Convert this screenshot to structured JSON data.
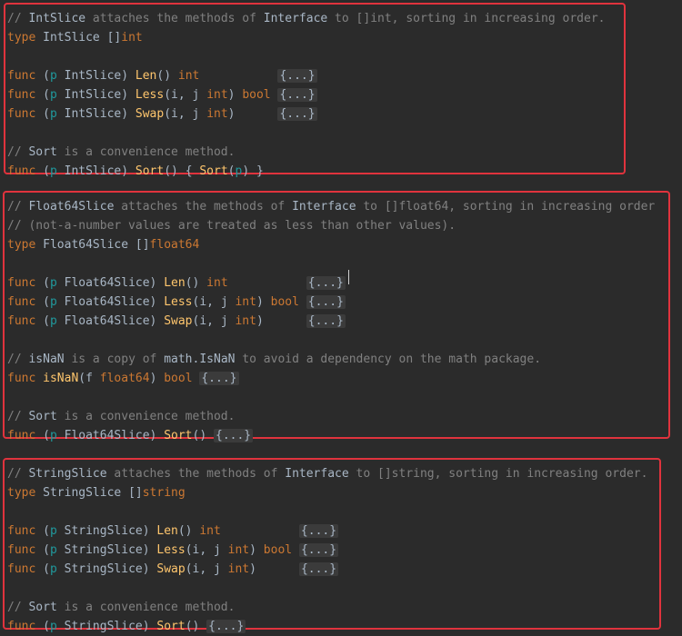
{
  "editor": {
    "blocks": [
      {
        "lines": [
          [
            [
              "c",
              "// "
            ],
            [
              "cb",
              "IntSlice"
            ],
            [
              "c",
              " attaches the methods of "
            ],
            [
              "cb",
              "Interface"
            ],
            [
              "c",
              " to []int, sorting in increasing order."
            ]
          ],
          [
            [
              "k",
              "type "
            ],
            [
              "t",
              "IntSlice "
            ],
            [
              "p",
              "[]"
            ],
            [
              "k",
              "int"
            ]
          ],
          [],
          [
            [
              "k",
              "func "
            ],
            [
              "p",
              "("
            ],
            [
              "r",
              "p "
            ],
            [
              "t",
              "IntSlice"
            ],
            [
              "p",
              ") "
            ],
            [
              "f",
              "Len"
            ],
            [
              "p",
              "() "
            ],
            [
              "k",
              "int"
            ],
            [
              "p",
              "           "
            ],
            [
              "fold",
              "{...}"
            ]
          ],
          [
            [
              "k",
              "func "
            ],
            [
              "p",
              "("
            ],
            [
              "r",
              "p "
            ],
            [
              "t",
              "IntSlice"
            ],
            [
              "p",
              ") "
            ],
            [
              "f",
              "Less"
            ],
            [
              "p",
              "(i, j "
            ],
            [
              "k",
              "int"
            ],
            [
              "p",
              ") "
            ],
            [
              "k",
              "bool"
            ],
            [
              "p",
              " "
            ],
            [
              "fold",
              "{...}"
            ]
          ],
          [
            [
              "k",
              "func "
            ],
            [
              "p",
              "("
            ],
            [
              "r",
              "p "
            ],
            [
              "t",
              "IntSlice"
            ],
            [
              "p",
              ") "
            ],
            [
              "f",
              "Swap"
            ],
            [
              "p",
              "(i, j "
            ],
            [
              "k",
              "int"
            ],
            [
              "p",
              ")      "
            ],
            [
              "fold",
              "{...}"
            ]
          ],
          [],
          [
            [
              "c",
              "// "
            ],
            [
              "cb",
              "Sort"
            ],
            [
              "c",
              " is a convenience method."
            ]
          ],
          [
            [
              "k",
              "func "
            ],
            [
              "p",
              "("
            ],
            [
              "r",
              "p "
            ],
            [
              "t",
              "IntSlice"
            ],
            [
              "p",
              ") "
            ],
            [
              "f",
              "Sort"
            ],
            [
              "p",
              "() { "
            ],
            [
              "f",
              "Sort"
            ],
            [
              "p",
              "("
            ],
            [
              "r",
              "p"
            ],
            [
              "p",
              ") }"
            ]
          ]
        ]
      },
      {
        "lines": [
          [
            [
              "c",
              "// "
            ],
            [
              "cb",
              "Float64Slice"
            ],
            [
              "c",
              " attaches the methods of "
            ],
            [
              "cb",
              "Interface"
            ],
            [
              "c",
              " to []float64, sorting in increasing order"
            ]
          ],
          [
            [
              "c",
              "// (not-a-number values are treated as less than other values)."
            ]
          ],
          [
            [
              "k",
              "type "
            ],
            [
              "t",
              "Float64Slice "
            ],
            [
              "p",
              "[]"
            ],
            [
              "k",
              "float64"
            ]
          ],
          [],
          [
            [
              "k",
              "func "
            ],
            [
              "p",
              "("
            ],
            [
              "r",
              "p "
            ],
            [
              "t",
              "Float64Slice"
            ],
            [
              "p",
              ") "
            ],
            [
              "f",
              "Len"
            ],
            [
              "p",
              "() "
            ],
            [
              "k",
              "int"
            ],
            [
              "p",
              "           "
            ],
            [
              "fold",
              "{...}"
            ]
          ],
          [
            [
              "k",
              "func "
            ],
            [
              "p",
              "("
            ],
            [
              "r",
              "p "
            ],
            [
              "t",
              "Float64Slice"
            ],
            [
              "p",
              ") "
            ],
            [
              "f",
              "Less"
            ],
            [
              "p",
              "(i, j "
            ],
            [
              "k",
              "int"
            ],
            [
              "p",
              ") "
            ],
            [
              "k",
              "bool"
            ],
            [
              "p",
              " "
            ],
            [
              "fold",
              "{...}"
            ]
          ],
          [
            [
              "k",
              "func "
            ],
            [
              "p",
              "("
            ],
            [
              "r",
              "p "
            ],
            [
              "t",
              "Float64Slice"
            ],
            [
              "p",
              ") "
            ],
            [
              "f",
              "Swap"
            ],
            [
              "p",
              "(i, j "
            ],
            [
              "k",
              "int"
            ],
            [
              "p",
              ")      "
            ],
            [
              "fold",
              "{...}"
            ]
          ],
          [],
          [
            [
              "c",
              "// "
            ],
            [
              "cb",
              "isNaN"
            ],
            [
              "c",
              " is a copy of "
            ],
            [
              "cb",
              "math.IsNaN"
            ],
            [
              "c",
              " to avoid a dependency on the math package."
            ]
          ],
          [
            [
              "k",
              "func "
            ],
            [
              "f",
              "isNaN"
            ],
            [
              "p",
              "(f "
            ],
            [
              "k",
              "float64"
            ],
            [
              "p",
              ") "
            ],
            [
              "k",
              "bool"
            ],
            [
              "p",
              " "
            ],
            [
              "fold",
              "{...}"
            ]
          ],
          [],
          [
            [
              "c",
              "// "
            ],
            [
              "cb",
              "Sort"
            ],
            [
              "c",
              " is a convenience method."
            ]
          ],
          [
            [
              "k",
              "func "
            ],
            [
              "p",
              "("
            ],
            [
              "r",
              "p "
            ],
            [
              "t",
              "Float64Slice"
            ],
            [
              "p",
              ") "
            ],
            [
              "f",
              "Sort"
            ],
            [
              "p",
              "() "
            ],
            [
              "fold",
              "{...}"
            ]
          ]
        ]
      },
      {
        "lines": [
          [
            [
              "c",
              "// "
            ],
            [
              "cb",
              "StringSlice"
            ],
            [
              "c",
              " attaches the methods of "
            ],
            [
              "cb",
              "Interface"
            ],
            [
              "c",
              " to []string, sorting in increasing order."
            ]
          ],
          [
            [
              "k",
              "type "
            ],
            [
              "t",
              "StringSlice "
            ],
            [
              "p",
              "[]"
            ],
            [
              "k",
              "string"
            ]
          ],
          [],
          [
            [
              "k",
              "func "
            ],
            [
              "p",
              "("
            ],
            [
              "r",
              "p "
            ],
            [
              "t",
              "StringSlice"
            ],
            [
              "p",
              ") "
            ],
            [
              "f",
              "Len"
            ],
            [
              "p",
              "() "
            ],
            [
              "k",
              "int"
            ],
            [
              "p",
              "           "
            ],
            [
              "fold",
              "{...}"
            ]
          ],
          [
            [
              "k",
              "func "
            ],
            [
              "p",
              "("
            ],
            [
              "r",
              "p "
            ],
            [
              "t",
              "StringSlice"
            ],
            [
              "p",
              ") "
            ],
            [
              "f",
              "Less"
            ],
            [
              "p",
              "(i, j "
            ],
            [
              "k",
              "int"
            ],
            [
              "p",
              ") "
            ],
            [
              "k",
              "bool"
            ],
            [
              "p",
              " "
            ],
            [
              "fold",
              "{...}"
            ]
          ],
          [
            [
              "k",
              "func "
            ],
            [
              "p",
              "("
            ],
            [
              "r",
              "p "
            ],
            [
              "t",
              "StringSlice"
            ],
            [
              "p",
              ") "
            ],
            [
              "f",
              "Swap"
            ],
            [
              "p",
              "(i, j "
            ],
            [
              "k",
              "int"
            ],
            [
              "p",
              ")      "
            ],
            [
              "fold",
              "{...}"
            ]
          ],
          [],
          [
            [
              "c",
              "// "
            ],
            [
              "cb",
              "Sort"
            ],
            [
              "c",
              " is a convenience method."
            ]
          ],
          [
            [
              "k",
              "func "
            ],
            [
              "p",
              "("
            ],
            [
              "r",
              "p "
            ],
            [
              "t",
              "StringSlice"
            ],
            [
              "p",
              ") "
            ],
            [
              "f",
              "Sort"
            ],
            [
              "p",
              "() "
            ],
            [
              "fold",
              "{...}"
            ]
          ]
        ]
      }
    ]
  },
  "colors": {
    "background": "#2b2b2b",
    "highlight_border": "#e0333d"
  }
}
